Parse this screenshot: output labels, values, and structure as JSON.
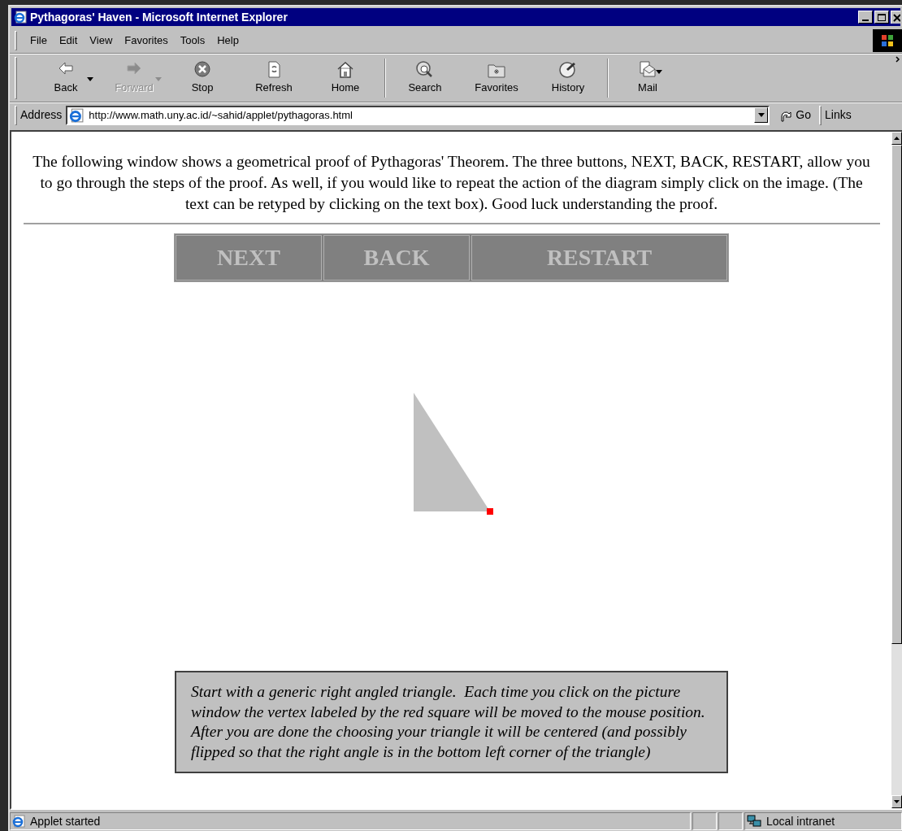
{
  "window": {
    "title": "Pythagoras' Haven - Microsoft Internet Explorer"
  },
  "menu": [
    "File",
    "Edit",
    "View",
    "Favorites",
    "Tools",
    "Help"
  ],
  "toolbar": [
    {
      "label": "Back",
      "kind": "back",
      "disabled": false,
      "dropdown": true
    },
    {
      "label": "Forward",
      "kind": "forward",
      "disabled": true,
      "dropdown": true
    },
    {
      "label": "Stop",
      "kind": "stop",
      "disabled": false,
      "dropdown": false
    },
    {
      "label": "Refresh",
      "kind": "refresh",
      "disabled": false,
      "dropdown": false
    },
    {
      "label": "Home",
      "kind": "home",
      "disabled": false,
      "dropdown": false
    },
    {
      "kind": "separator"
    },
    {
      "label": "Search",
      "kind": "search",
      "disabled": false,
      "dropdown": false
    },
    {
      "label": "Favorites",
      "kind": "favorites",
      "disabled": false,
      "dropdown": false
    },
    {
      "label": "History",
      "kind": "history",
      "disabled": false,
      "dropdown": false
    },
    {
      "kind": "separator"
    },
    {
      "label": "Mail",
      "kind": "mail",
      "disabled": false,
      "dropdown": true
    }
  ],
  "address_bar": {
    "label": "Address",
    "url": "http://www.math.uny.ac.id/~sahid/applet/pythagoras.html",
    "go": "Go",
    "links": "Links"
  },
  "page": {
    "intro": "The following window shows a geometrical proof of Pythagoras' Theorem. The three buttons, NEXT, BACK, RESTART, allow you to go through the steps of the proof. As well, if you would like to repeat the action of the diagram simply click on the image. (The text can be retyped by clicking on the text box). Good luck understanding the proof.",
    "applet_buttons": [
      "NEXT",
      "BACK",
      "RESTART"
    ],
    "caption": "Start with a generic right angled triangle.  Each time you click on the picture window the vertex labeled by the red square will be moved to the mouse position.  After you are done the choosing your triangle it will be centered (and possibly flipped so that the right angle is in the bottom left corner of the triangle)"
  },
  "status_bar": {
    "text": "Applet started",
    "zone": "Local intranet"
  }
}
